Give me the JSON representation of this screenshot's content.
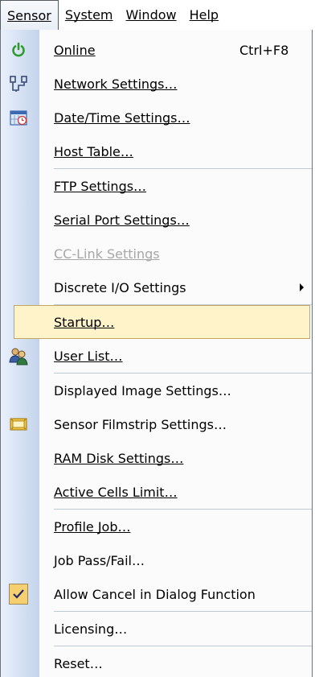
{
  "menubar": [
    {
      "label": "Sensor",
      "active": true
    },
    {
      "label": "System"
    },
    {
      "label": "Window"
    },
    {
      "label": "Help"
    }
  ],
  "menu": {
    "online": {
      "label": "Online",
      "shortcut": "Ctrl+F8",
      "icon": "power-icon"
    },
    "network_settings": {
      "label": "Network Settings…",
      "icon": "network-icon"
    },
    "date_time_settings": {
      "label": "Date/Time Settings…",
      "icon": "calendar-clock-icon"
    },
    "host_table": {
      "label": "Host Table…"
    },
    "ftp_settings": {
      "label": "FTP Settings…"
    },
    "serial_port_settings": {
      "label": "Serial Port Settings…"
    },
    "cc_link_settings": {
      "label": "CC-Link Settings",
      "disabled": true
    },
    "discrete_io_settings": {
      "label": "Discrete I/O Settings",
      "submenu": true
    },
    "startup": {
      "label": "Startup…",
      "highlighted": true
    },
    "user_list": {
      "label": "User List…",
      "icon": "users-icon"
    },
    "displayed_image_settings": {
      "label": "Displayed Image Settings…"
    },
    "sensor_filmstrip_settings": {
      "label": "Sensor Filmstrip Settings…",
      "icon": "filmstrip-icon"
    },
    "ram_disk_settings": {
      "label": "RAM Disk Settings…"
    },
    "active_cells_limit": {
      "label": "Active Cells Limit…"
    },
    "profile_job": {
      "label": "Profile Job…"
    },
    "job_pass_fail": {
      "label": "Job Pass/Fail…"
    },
    "allow_cancel": {
      "label": "Allow Cancel in Dialog Function",
      "checked": true,
      "icon": "checkmark-icon"
    },
    "licensing": {
      "label": "Licensing…"
    },
    "reset": {
      "label": "Reset…"
    }
  },
  "colors": {
    "highlight_bg": "#fff3c9",
    "highlight_border": "#c7a660",
    "gutter": "#c4d3ec",
    "disabled_text": "#a7a7a7"
  }
}
